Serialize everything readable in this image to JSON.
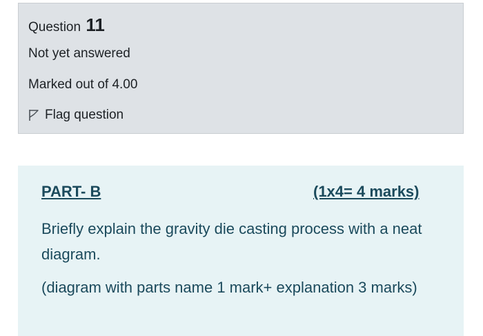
{
  "question_info": {
    "label": "Question",
    "number": "11",
    "status": "Not yet answered",
    "marks": "Marked out of 4.00",
    "flag_label": "Flag question"
  },
  "question_content": {
    "part": "PART- B",
    "marks_allocation": "(1x4= 4 marks)",
    "text": "Briefly explain the gravity die casting process with a neat diagram.",
    "note": "(diagram with parts name 1 mark+ explanation 3 marks)"
  }
}
